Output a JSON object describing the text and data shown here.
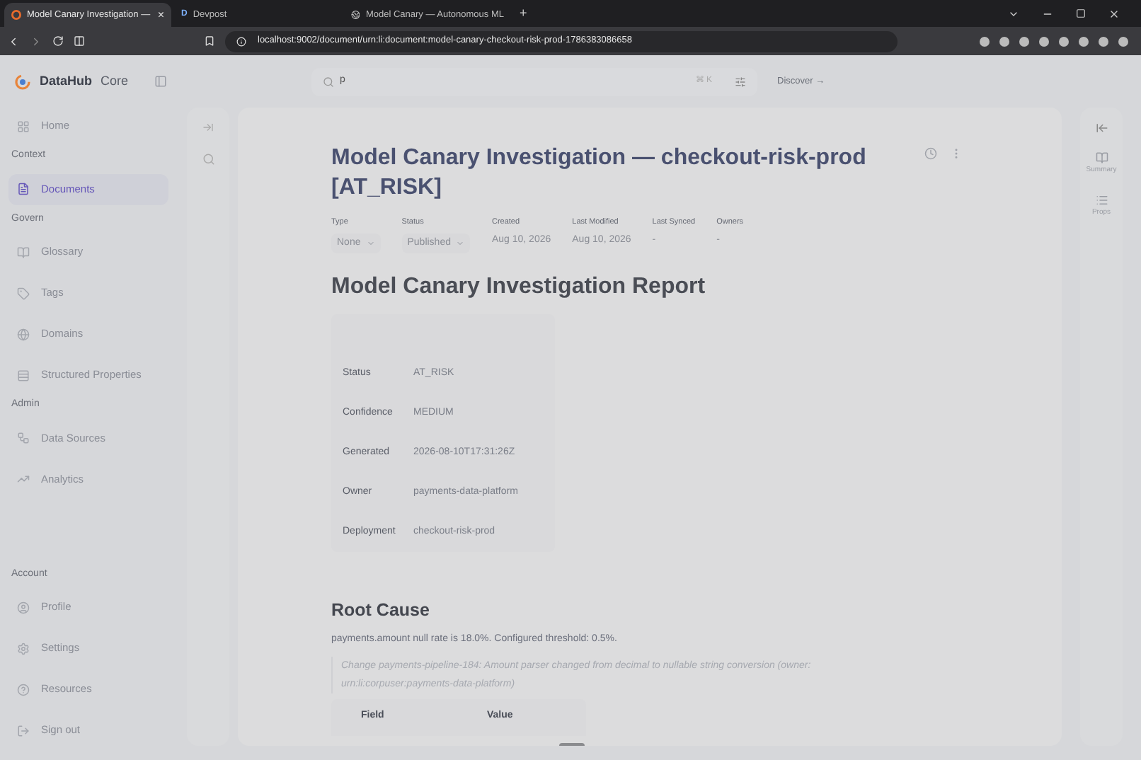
{
  "browser": {
    "tabs": [
      {
        "title": "Model Canary Investigation —",
        "selected": true,
        "close": "×"
      },
      {
        "title": "Devpost",
        "selected": false,
        "letter": "D"
      },
      {
        "title": "Model Canary — Autonomous ML",
        "selected": false
      }
    ],
    "new_tab": "+",
    "url": "localhost:9002/document/urn:li:document:model-canary-checkout-risk-prod-1786383086658"
  },
  "header": {
    "brand": "DataHub",
    "edition": "Core",
    "search": {
      "value": "p",
      "shortcut": "⌘ K"
    },
    "discover": "Discover →"
  },
  "sidebar": {
    "home": {
      "label": "Home",
      "selected": false
    },
    "sections": [
      {
        "heading": "Context",
        "items": [
          {
            "label": "Documents",
            "selected": true
          }
        ]
      },
      {
        "heading": "Govern",
        "items": [
          {
            "label": "Glossary",
            "selected": false
          },
          {
            "label": "Tags",
            "selected": false
          },
          {
            "label": "Domains",
            "selected": false
          },
          {
            "label": "Structured Properties",
            "selected": false
          }
        ]
      },
      {
        "heading": "Admin",
        "items": [
          {
            "label": "Data Sources",
            "selected": false
          },
          {
            "label": "Analytics",
            "selected": false
          }
        ]
      }
    ],
    "account": {
      "heading": "Account",
      "items": [
        {
          "label": "Profile",
          "selected": false
        },
        {
          "label": "Settings",
          "selected": false
        },
        {
          "label": "Resources",
          "selected": false
        },
        {
          "label": "Sign out",
          "selected": false
        }
      ]
    }
  },
  "document": {
    "title": "Model Canary Investigation — checkout-risk-prod [AT_RISK]",
    "meta": [
      {
        "label": "Type",
        "value": "None",
        "kind": "dropdown"
      },
      {
        "label": "Status",
        "value": "Published",
        "kind": "dropdown"
      },
      {
        "label": "Created",
        "value": "Aug 10, 2026",
        "kind": "text"
      },
      {
        "label": "Last Modified",
        "value": "Aug 10, 2026",
        "kind": "text"
      },
      {
        "label": "Last Synced",
        "value": "-",
        "kind": "text"
      },
      {
        "label": "Owners",
        "value": "-",
        "kind": "text"
      }
    ],
    "report_title": "Model Canary Investigation Report",
    "summary_rows": [
      {
        "label": "Status",
        "value": "AT_RISK"
      },
      {
        "label": "Confidence",
        "value": "MEDIUM"
      },
      {
        "label": "Generated",
        "value": "2026-08-10T17:31:26Z"
      },
      {
        "label": "Owner",
        "value": "payments-data-platform"
      },
      {
        "label": "Deployment",
        "value": "checkout-risk-prod"
      }
    ],
    "root_cause_heading": "Root Cause",
    "root_cause_text": "payments.amount null rate is 18.0%. Configured threshold: 0.5%.",
    "quote": "Change payments-pipeline-184: Amount parser changed from decimal to nullable string conversion (owner: urn:li:corpuser:payments-data-platform)",
    "field_table_columns": [
      "Field",
      "Value"
    ]
  },
  "right_rail": [
    {
      "label": "Summary"
    },
    {
      "label": "Props"
    }
  ]
}
